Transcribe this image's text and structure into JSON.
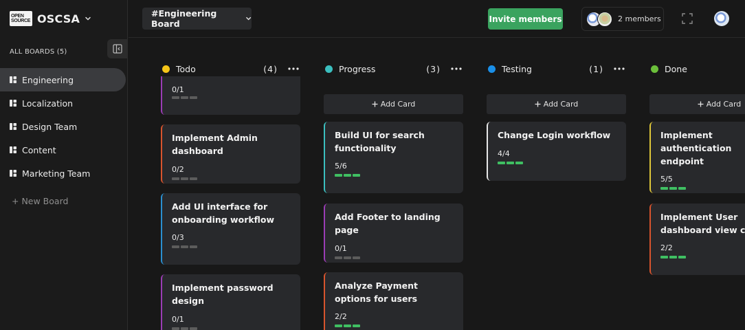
{
  "brand": {
    "logo_line1": "OPEN",
    "logo_line2": "SOURCE",
    "name": "OSCSA"
  },
  "sidebar": {
    "heading": "ALL BOARDS (5)",
    "boards": [
      "Engineering",
      "Localization",
      "Design Team",
      "Content",
      "Marketing Team"
    ],
    "active_board": "Engineering",
    "new_board_label": "+ New Board"
  },
  "header": {
    "board_name": "#Engineering Board",
    "invite_label": "Invite members",
    "members_label": "2 members"
  },
  "colors": {
    "todo": "#f5c518",
    "progress": "#3bbfbf",
    "testing": "#1a8fe8",
    "done": "#6bbf3a",
    "accent_green": "#3aa35f",
    "progress_done": "#3fbf62"
  },
  "columns": [
    {
      "title": "Todo",
      "count": "(4)",
      "color": "#f5c518",
      "has_add_card": false,
      "cards": [
        {
          "title": "",
          "progress": "0/1",
          "done": 0,
          "total": 3,
          "border": "#9b3cb5"
        },
        {
          "title": "Implement Admin dashboard",
          "progress": "0/2",
          "done": 0,
          "total": 3,
          "border": "#d8542d"
        },
        {
          "title": "Add UI interface for onboarding workflow",
          "progress": "0/3",
          "done": 0,
          "total": 3,
          "border": "#2a8fd0"
        },
        {
          "title": "Implement password design",
          "progress": "0/1",
          "done": 0,
          "total": 3,
          "border": "#9b3cb5"
        }
      ]
    },
    {
      "title": "Progress",
      "count": "(3)",
      "color": "#3bbfbf",
      "has_add_card": true,
      "cards": [
        {
          "title": "Build UI for search functionality",
          "progress": "5/6",
          "done": 3,
          "total": 3,
          "border": "#3bbfbf"
        },
        {
          "title": "Add Footer to landing page",
          "progress": "0/1",
          "done": 0,
          "total": 3,
          "border": "#9b3cb5"
        },
        {
          "title": "Analyze Payment options for users",
          "progress": "2/2",
          "done": 3,
          "total": 3,
          "border": "#d8542d"
        }
      ]
    },
    {
      "title": "Testing",
      "count": "(1)",
      "color": "#1a8fe8",
      "has_add_card": true,
      "cards": [
        {
          "title": "Change Login workflow",
          "progress": "4/4",
          "done": 3,
          "total": 3,
          "border": "#e8e8e8"
        }
      ]
    },
    {
      "title": "Done",
      "count": "",
      "color": "#6bbf3a",
      "has_add_card": true,
      "cards": [
        {
          "title": "Implement authentication endpoint",
          "progress": "5/5",
          "done": 3,
          "total": 3,
          "border": "#e0c73a"
        },
        {
          "title": "Implement User dashboard view course",
          "progress": "2/2",
          "done": 3,
          "total": 3,
          "border": "#d8542d"
        }
      ]
    }
  ],
  "add_card_label": "Add Card",
  "icons": {
    "brand_chevron": "chevron-down-icon",
    "collapse": "sidebar-collapse-icon",
    "board_item": "board-icon",
    "fullscreen": "fullscreen-icon",
    "more": "more-dots-icon",
    "add": "plus-icon"
  }
}
